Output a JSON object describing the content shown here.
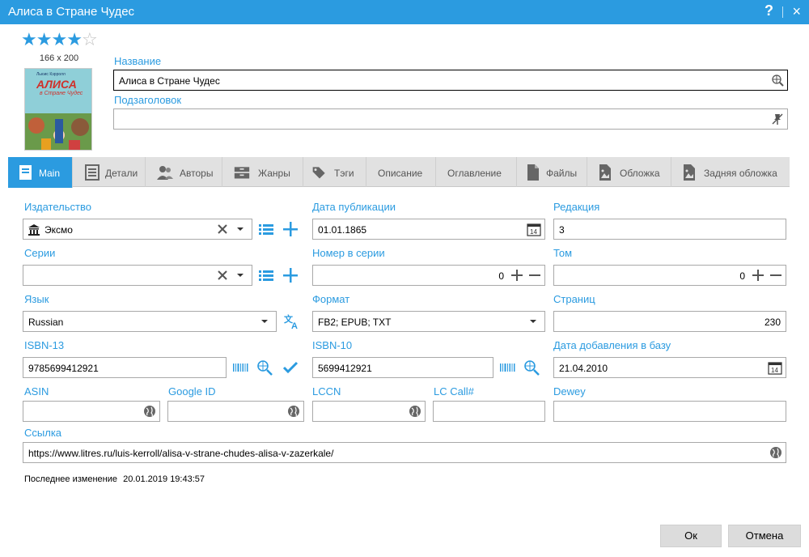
{
  "window": {
    "title": "Алиса в Стране Чудес",
    "help": "?",
    "close": "×"
  },
  "rating": {
    "value": 4,
    "max": 5
  },
  "cover": {
    "size_text": "166 x 200",
    "book_title_line1": "АЛИСА",
    "book_title_line2": "в Стране Чудес",
    "author_small": "Льюис Кэрролл"
  },
  "title_field": {
    "label": "Название",
    "value": "Алиса в Стране Чудес"
  },
  "subtitle_field": {
    "label": "Подзаголовок",
    "value": ""
  },
  "tabs": [
    {
      "label": "Main",
      "icon": "book-icon"
    },
    {
      "label": "Детали",
      "icon": "list-icon"
    },
    {
      "label": "Авторы",
      "icon": "users-icon"
    },
    {
      "label": "Жанры",
      "icon": "shelf-icon"
    },
    {
      "label": "Тэги",
      "icon": "tags-icon"
    },
    {
      "label": "Описание",
      "icon": ""
    },
    {
      "label": "Оглавление",
      "icon": ""
    },
    {
      "label": "Файлы",
      "icon": "file-icon"
    },
    {
      "label": "Обложка",
      "icon": "image-icon"
    },
    {
      "label": "Задняя обложка",
      "icon": "image-icon"
    }
  ],
  "fields": {
    "publisher": {
      "label": "Издательство",
      "value": "Эксмо"
    },
    "pub_date": {
      "label": "Дата публикации",
      "value": "01.01.1865"
    },
    "edition": {
      "label": "Редакция",
      "value": "3"
    },
    "series": {
      "label": "Серии",
      "value": ""
    },
    "series_no": {
      "label": "Номер в серии",
      "value": "0"
    },
    "volume": {
      "label": "Том",
      "value": "0"
    },
    "language": {
      "label": "Язык",
      "value": "Russian"
    },
    "format": {
      "label": "Формат",
      "value": "FB2; EPUB; TXT"
    },
    "pages": {
      "label": "Страниц",
      "value": "230"
    },
    "isbn13": {
      "label": "ISBN-13",
      "value": "9785699412921"
    },
    "isbn10": {
      "label": "ISBN-10",
      "value": "5699412921"
    },
    "date_added": {
      "label": "Дата добавления в базу",
      "value": "21.04.2010"
    },
    "asin": {
      "label": "ASIN",
      "value": ""
    },
    "google_id": {
      "label": "Google ID",
      "value": ""
    },
    "lccn": {
      "label": "LCCN",
      "value": ""
    },
    "lc_call": {
      "label": "LC Call#",
      "value": ""
    },
    "dewey": {
      "label": "Dewey",
      "value": ""
    },
    "link": {
      "label": "Ссылка",
      "value": "https://www.litres.ru/luis-kerroll/alisa-v-strane-chudes-alisa-v-zazerkale/"
    }
  },
  "last_modified": {
    "label": "Последнее изменение",
    "value": "20.01.2019 19:43:57"
  },
  "buttons": {
    "ok": "Ок",
    "cancel": "Отмена"
  },
  "colors": {
    "accent": "#2b9be0",
    "tab_bar": "#e1e1e1",
    "button": "#dcdcdc"
  }
}
